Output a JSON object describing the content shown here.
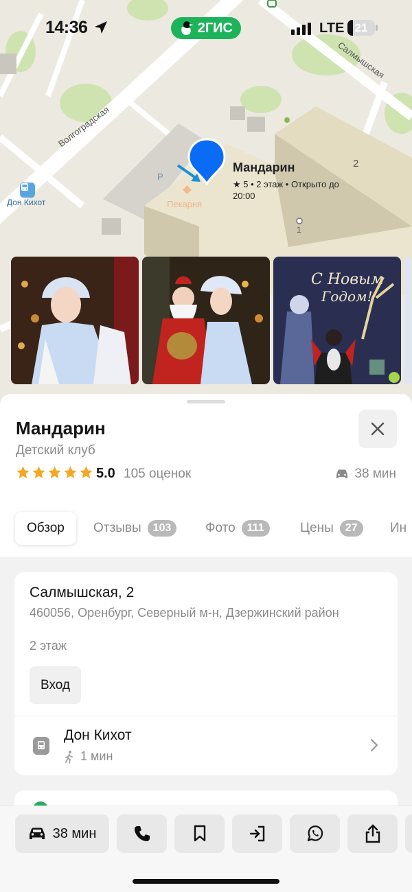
{
  "status_bar": {
    "time": "14:36",
    "app_badge": "2ГИС",
    "network": "LTE",
    "battery": "21",
    "battery_level": 0.21
  },
  "map": {
    "streets": [
      "Волгоградская",
      "Салмышская"
    ],
    "poi": {
      "name": "Мандарин",
      "details_line1": "★ 5 • 2 этаж • Открыто до",
      "details_line2": "20:00"
    },
    "bakery_label": "Пекарня",
    "bus_stop_label": "Дон Кихот",
    "parking_label": "P",
    "house_numbers": [
      "2",
      "1"
    ]
  },
  "place": {
    "title": "Мандарин",
    "category": "Детский клуб",
    "rating": "5.0",
    "rating_stars": 5,
    "rating_count": "105 оценок",
    "drive_time": "38 мин"
  },
  "tabs": [
    {
      "label": "Обзор",
      "count": ""
    },
    {
      "label": "Отзывы",
      "count": "103"
    },
    {
      "label": "Фото",
      "count": "111"
    },
    {
      "label": "Цены",
      "count": "27"
    },
    {
      "label": "Ин",
      "count": ""
    }
  ],
  "address": {
    "street": "Салмышская, 2",
    "full": "460056, Оренбург, Северный м-н, Дзержинский район",
    "floor": "2 этаж",
    "entry_button": "Вход"
  },
  "nearest_stop": {
    "name": "Дон Кихот",
    "walk_time": "1 мин"
  },
  "actions": {
    "route_time": "38 мин",
    "buttons": [
      "phone-icon",
      "bookmark-icon",
      "entrance-icon",
      "whatsapp-icon",
      "share-icon"
    ]
  },
  "colors": {
    "brand_green": "#1db35a",
    "pin_blue": "#0a6cf5",
    "star_orange": "#f5a623"
  }
}
